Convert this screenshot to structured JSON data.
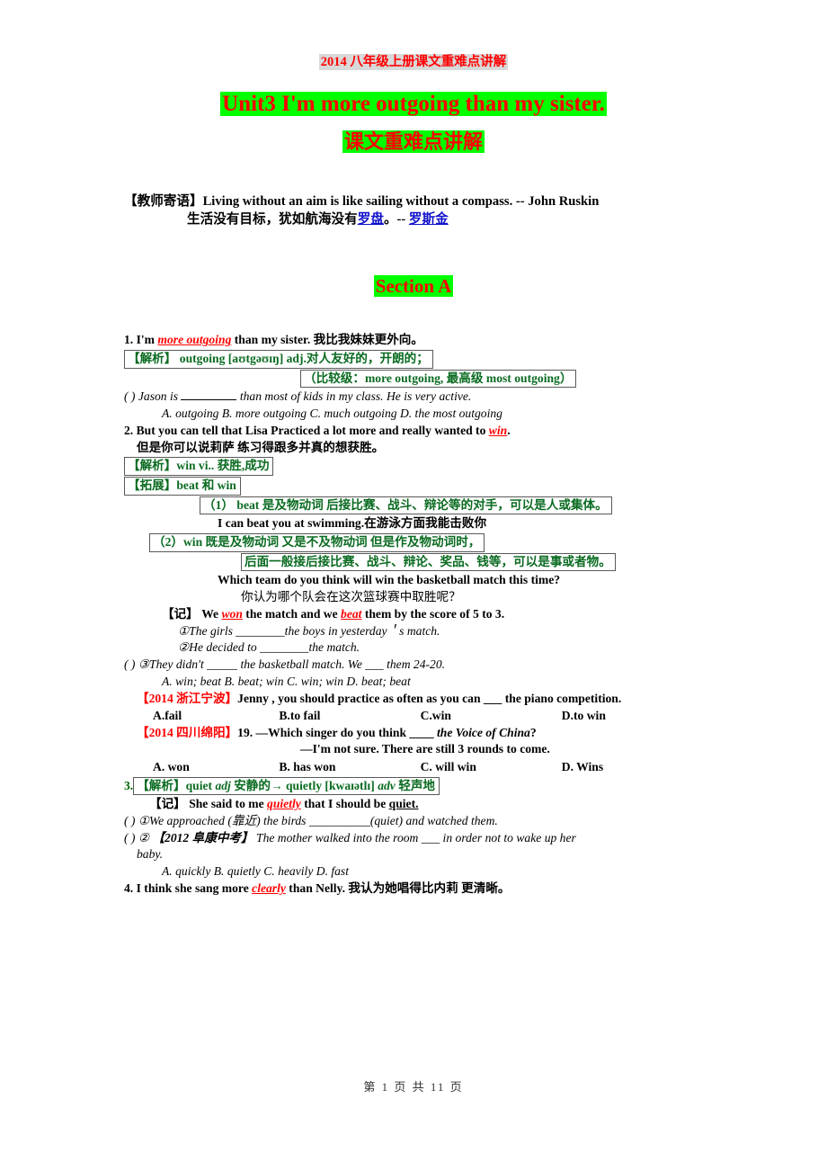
{
  "header": {
    "banner": "2014 八年级上册课文重难点讲解",
    "title_main": "Unit3 I'm more outgoing than my sister.",
    "title_sub": "课文重难点讲解"
  },
  "motto": {
    "label": "【教师寄语】",
    "english": "Living without an aim is like sailing without a compass. -- John Ruskin",
    "chinese_pre": "生活没有目标，犹如航海没有",
    "chinese_link1": "罗盘",
    "chinese_mid": "。-- ",
    "chinese_link2": "罗斯金"
  },
  "section": {
    "label": "Section A"
  },
  "item1": {
    "number": "1.",
    "sentence_pre": "I'm ",
    "sentence_key": "more outgoing",
    "sentence_post": " than my sister.",
    "translation": "我比我妹妹更外向。",
    "box_analysis": "【解析】  outgoing [aʊtgəʊɪŋ]   adj.对人友好的，开朗的；",
    "box_degrees": "（比较级：more outgoing, 最高级  most outgoing）",
    "question": {
      "bracket": "(      )",
      "stem_a": "Jason is ",
      "stem_b": " than most of kids in my class. He is very active.",
      "options": "A. outgoing     B. more outgoing     C. much outgoing D. the most outgoing"
    }
  },
  "item2": {
    "number": "2.",
    "sentence_pre": "But you can tell that Lisa Practiced a lot more and really wanted to ",
    "sentence_key": "win",
    "sentence_post": ".",
    "translation": "但是你可以说莉萨 练习得跟多并真的想获胜。",
    "box_analysis": "【解析】win vi.. 获胜,成功",
    "box_extension": "【拓展】beat 和 win",
    "box_beat": "（1）  beat 是及物动词   后接比赛、战斗、辩论等的对手，可以是人或集体。",
    "example_beat_en": "I can beat you at swimming.",
    "example_beat_zh": "在游泳方面我能击败你",
    "box_win1": "（2）win 既是及物动词   又是不及物动词   但是作及物动词时，",
    "box_win2": "后面一般接后接比赛、战斗、辩论、奖品、钱等，可以是事或者物。",
    "example_which_en": "Which team do you think will win the basketball match this time?",
    "example_which_zh": "你认为哪个队会在这次篮球赛中取胜呢？",
    "memo_label": "【记】",
    "memo_pre": "We ",
    "memo_key1": "won",
    "memo_mid": " the match and we ",
    "memo_key2": "beat",
    "memo_post": " them by the score of 5 to 3.",
    "ex1": "①The girls ________the boys in yesterday＇s match.",
    "ex2": "②He decided to ________the match.",
    "ex3_bracket": "(      )",
    "ex3": "③They didn't _____ the basketball match. We ___ them 24-20.",
    "ex3_options": "A. win; beat     B. beat; win     C. win; win     D. beat; beat",
    "exam1_tag": "【2014 浙江宁波】",
    "exam1_stem": "Jenny , you should practice as often as you can ___ the piano competition.",
    "exam1_options": [
      "A.fail",
      "B.to fail",
      "C.win",
      "D.to win"
    ],
    "exam2_tag": "【2014 四川绵阳】",
    "exam2_stem_a": "19. —Which singer do you think ____ ",
    "exam2_stem_italic": "the Voice of China",
    "exam2_stem_b": "?",
    "exam2_stem2": "—I'm not sure. There are still 3 rounds to come.",
    "exam2_options": [
      "A. won",
      "B. has won",
      "C. will win",
      "D. Wins"
    ]
  },
  "item3": {
    "number": "3.",
    "box_analysis_a": "【解析】quiet ",
    "box_analysis_adj": "adj",
    "box_analysis_b": " 安静的→ quietly [kwaɪətlɪ]   ",
    "box_analysis_adv": "adv",
    "box_analysis_c": " 轻声地",
    "memo_label": "【记】",
    "memo_pre": "She said to me ",
    "memo_key1": "quietly",
    "memo_mid": " that I should be ",
    "memo_key2": "quiet.",
    "ex1_bracket": "(      )",
    "ex1": "①We approached (靠近) the birds __________(quiet) and watched them.",
    "ex2_bracket": "(      )",
    "ex2_a": "② ",
    "ex2_tag": "【2012 阜康中考】",
    "ex2_b": "  The mother walked into the room ___ in order not to wake up her",
    "ex2_c": "baby.",
    "ex2_options": "A. quickly        B. quietly       C. heavily        D. fast"
  },
  "item4": {
    "number": "4.",
    "sentence_pre": "I think she sang more ",
    "sentence_key": "clearly",
    "sentence_post": " than Nelly.",
    "translation": "我认为她唱得比内莉 更清晰。"
  },
  "footer": {
    "text": "第 1 页 共 11 页"
  },
  "colors": {
    "red": "#ff0000",
    "green_highlight": "#00ff00",
    "gray_highlight": "#d9d9d9",
    "dark_green": "#0a6b21",
    "link_blue": "#1111cc"
  }
}
